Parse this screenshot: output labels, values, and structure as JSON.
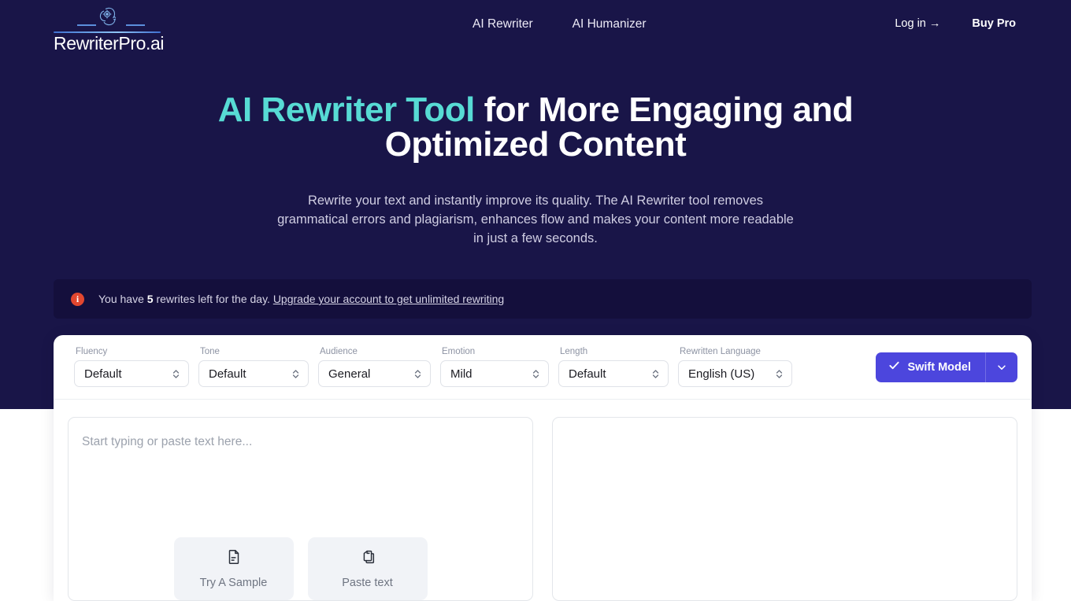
{
  "header": {
    "logo": {
      "wordmark": "RewriterPro.ai",
      "icon_name": "ai-brain-icon"
    },
    "nav": [
      {
        "label": "AI Rewriter",
        "name": "nav-link-ai-rewriter"
      },
      {
        "label": "AI Humanizer",
        "name": "nav-link-ai-humanizer"
      }
    ],
    "auth": [
      {
        "label": "Log in →",
        "name": "login-link"
      },
      {
        "label": "Buy Pro",
        "name": "buy-pro-link"
      }
    ]
  },
  "hero": {
    "title_accent": "AI Rewriter Tool",
    "title_rest": " for More Engaging and Optimized Content",
    "subtitle": "Rewrite your text and instantly improve its quality. The AI Rewriter tool removes grammatical errors and plagiarism, enhances flow and makes your content more readable in just a few seconds."
  },
  "alert": {
    "icon_name": "info-circle-icon",
    "icon_glyph": "i",
    "text_before": "You have ",
    "count": "5",
    "text_after": " rewrites left for the day. ",
    "link_label": "Upgrade your account to get unlimited rewriting"
  },
  "controls": {
    "selects": [
      {
        "label": "Fluency",
        "value": "Default",
        "name": "select-fluency"
      },
      {
        "label": "Tone",
        "value": "Default",
        "name": "select-tone"
      },
      {
        "label": "Audience",
        "value": "General",
        "name": "select-audience"
      },
      {
        "label": "Emotion",
        "value": "Mild",
        "name": "select-emotion"
      },
      {
        "label": "Length",
        "value": "Default",
        "name": "select-length"
      },
      {
        "label": "Rewritten Language",
        "value": "English (US)",
        "name": "select-rewritten-language"
      }
    ],
    "model_button": {
      "label": "Swift Model",
      "check_icon": "check-icon",
      "caret_icon": "chevron-down-icon"
    }
  },
  "editor": {
    "input_placeholder": "Start typing or paste text here...",
    "output_placeholder": "",
    "actions": [
      {
        "label": "Try A Sample",
        "icon": "document-icon",
        "name": "try-a-sample-button"
      },
      {
        "label": "Paste text",
        "icon": "clipboard-copy-icon",
        "name": "paste-text-button"
      }
    ]
  },
  "colors": {
    "hero_background": "#191548",
    "accent_cyan": "#57dbd4",
    "brand_indigo": "#4c46dd",
    "alert_icon_red": "#e2472f",
    "alert_background": "#140f3c"
  }
}
